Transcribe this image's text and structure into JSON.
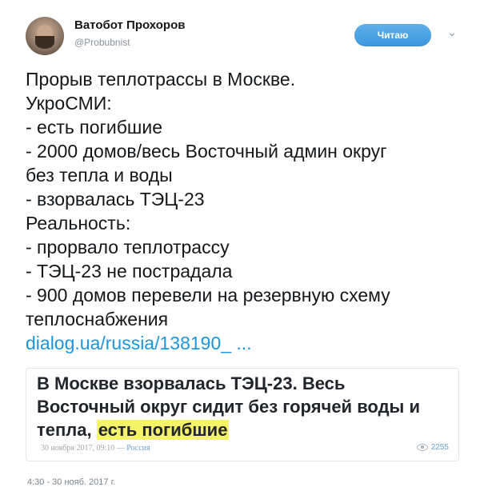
{
  "header": {
    "display_name": "Ватобот Прохоров",
    "handle": "@Probubnist",
    "follow_label": "Читаю",
    "more_icon": "chevron-down-icon"
  },
  "tweet": {
    "lines": [
      "Прорыв теплотрассы в Москве.",
      "УкроСМИ:",
      "- есть погибшие",
      "- 2000 домов/весь Восточный админ округ",
      "без тепла и воды",
      "- взорвалась ТЭЦ-23",
      "Реальность:",
      "- прорвало теплотрассу",
      "- ТЭЦ-23 не пострадала",
      "- 900 домов перевели на резервную схему",
      "теплоснабжения"
    ],
    "link": "dialog.ua/russia/138190_ ..."
  },
  "card": {
    "title_line1": "В Москве взорвалась ТЭЦ-23. Весь",
    "title_line2": "Восточный округ сидит без горячей воды и",
    "title_line3_plain": "тепла, ",
    "title_line3_highlight": "есть погибшие",
    "date": "30 ноября 2017, 09:10 — ",
    "rubric": "Россия",
    "views": "2255"
  },
  "timestamp": "4:30 - 30 нояб. 2017 г."
}
